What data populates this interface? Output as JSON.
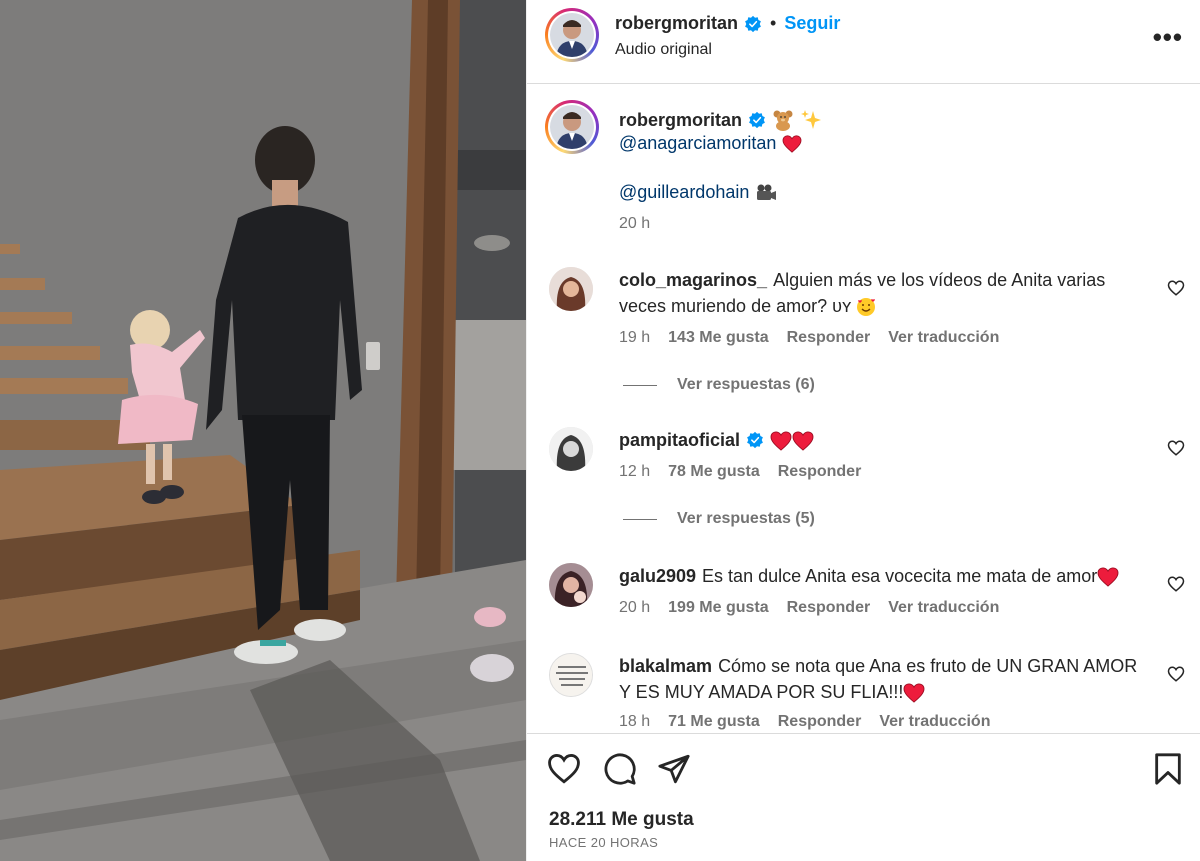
{
  "header": {
    "username": "robergmoritan",
    "separator": "•",
    "follow_label": "Seguir",
    "audio_label": "Audio original",
    "more_label": "•••"
  },
  "caption": {
    "username": "robergmoritan",
    "emojis": [
      "teddy-bear-icon",
      "sparkles-icon"
    ],
    "mention_1": "@anagarciamoritan",
    "mention_2": "@guilleardohain",
    "time": "20 h"
  },
  "comments": [
    {
      "username": "colo_magarinos_",
      "text": "Alguien más ve los vídeos de Anita varias veces muriendo de amor? ᴜʏ",
      "time": "19 h",
      "likes": "143 Me gusta",
      "reply": "Responder",
      "translate": "Ver traducción",
      "replies": "Ver respuestas (6)"
    },
    {
      "username": "pampitaoficial",
      "text": "",
      "time": "12 h",
      "likes": "78 Me gusta",
      "reply": "Responder",
      "replies": "Ver respuestas (5)"
    },
    {
      "username": "galu2909",
      "text": "Es tan dulce Anita esa vocecita me mata de amor",
      "time": "20 h",
      "likes": "199 Me gusta",
      "reply": "Responder",
      "translate": "Ver traducción"
    },
    {
      "username": "blakalmam",
      "text": "Cómo se nota que Ana es fruto de UN GRAN AMOR Y ES MUY AMADA POR SU FLIA!!!",
      "time": "18 h",
      "likes": "71 Me gusta",
      "reply": "Responder",
      "translate": "Ver traducción"
    }
  ],
  "footer": {
    "likes_count": "28.211 Me gusta",
    "post_time": "HACE 20 HORAS"
  },
  "colors": {
    "accent": "#0095f6",
    "heart_red": "#ed1c3c",
    "text": "#262626",
    "muted": "#737373"
  }
}
